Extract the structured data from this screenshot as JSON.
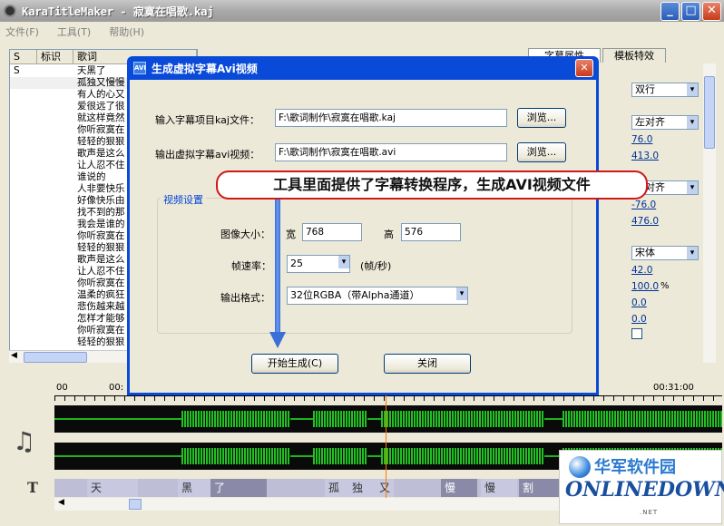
{
  "window": {
    "title": "KaraTitleMaker - 寂寞在唱歌.kaj"
  },
  "menu": [
    "文件(F)",
    "工具(T)",
    "帮助(H)"
  ],
  "lyrics_table": {
    "headers": [
      "S",
      "标识",
      "歌词"
    ],
    "rows": [
      {
        "s": "S",
        "text": "天黑了"
      },
      {
        "s": "",
        "text": "孤独又慢慢"
      },
      {
        "s": "",
        "text": "有人的心又"
      },
      {
        "s": "",
        "text": "爱很远了很"
      },
      {
        "s": "",
        "text": "就这样竟然"
      },
      {
        "s": "",
        "text": "你听寂寞在"
      },
      {
        "s": "",
        "text": "轻轻的狠狠"
      },
      {
        "s": "",
        "text": "歌声是这么"
      },
      {
        "s": "",
        "text": "让人忍不住"
      },
      {
        "s": "",
        "text": "谁说的"
      },
      {
        "s": "",
        "text": "人非要快乐"
      },
      {
        "s": "",
        "text": "好像快乐由"
      },
      {
        "s": "",
        "text": "找不到的那"
      },
      {
        "s": "",
        "text": "我会是谁的"
      },
      {
        "s": "",
        "text": "你听寂寞在"
      },
      {
        "s": "",
        "text": "轻轻的狠狠"
      },
      {
        "s": "",
        "text": "歌声是这么"
      },
      {
        "s": "",
        "text": "让人忍不住"
      },
      {
        "s": "",
        "text": "你听寂寞在"
      },
      {
        "s": "",
        "text": "温柔的疯狂"
      },
      {
        "s": "",
        "text": "悲伤越来越"
      },
      {
        "s": "",
        "text": "怎样才能够"
      },
      {
        "s": "",
        "text": "你听寂寞在"
      },
      {
        "s": "",
        "text": "轻轻的狠狠"
      }
    ]
  },
  "props_panel": {
    "tabs": [
      "字幕属性",
      "模板特效"
    ],
    "select_display": "双行",
    "select_align": "左对齐",
    "val1": "76.0",
    "val2": "413.0",
    "select_align2": "右对齐",
    "val3": "-76.0",
    "val4": "476.0",
    "select_font": "宋体",
    "val5": "42.0",
    "val6": "100.0",
    "percent": "%",
    "val7": "0.0",
    "val8": "0.0"
  },
  "timeline": {
    "start": "00",
    "mark1": "00:",
    "mark2": "00:31:00"
  },
  "text_track": [
    "天",
    "黑",
    "了",
    "孤",
    "独",
    "又",
    "慢",
    "慢",
    "割"
  ],
  "dialog": {
    "title": "生成虚拟字幕Avi视频",
    "input_label": "输入字幕项目kaj文件：",
    "input_value": "F:\\歌词制作\\寂寞在唱歌.kaj",
    "browse1": "浏览...",
    "output_label": "输出虚拟字幕avi视频：",
    "output_value": "F:\\歌词制作\\寂寞在唱歌.avi",
    "browse2": "浏览...",
    "group_label": "视频设置",
    "size_label": "图像大小：",
    "width_label": "宽",
    "width_value": "768",
    "height_label": "高",
    "height_value": "576",
    "fps_label": "帧速率：",
    "fps_value": "25",
    "fps_unit": "(帧/秒)",
    "format_label": "输出格式：",
    "format_value": "32位RGBA（带Alpha通道）",
    "start_button": "开始生成(C)",
    "close_button": "关闭"
  },
  "callout": {
    "text": "工具里面提供了字幕转换程序，生成AVI视频文件"
  },
  "watermark": {
    "cn": "华军软件园",
    "en": "ONLINEDOWN",
    "sub": ".NET"
  }
}
